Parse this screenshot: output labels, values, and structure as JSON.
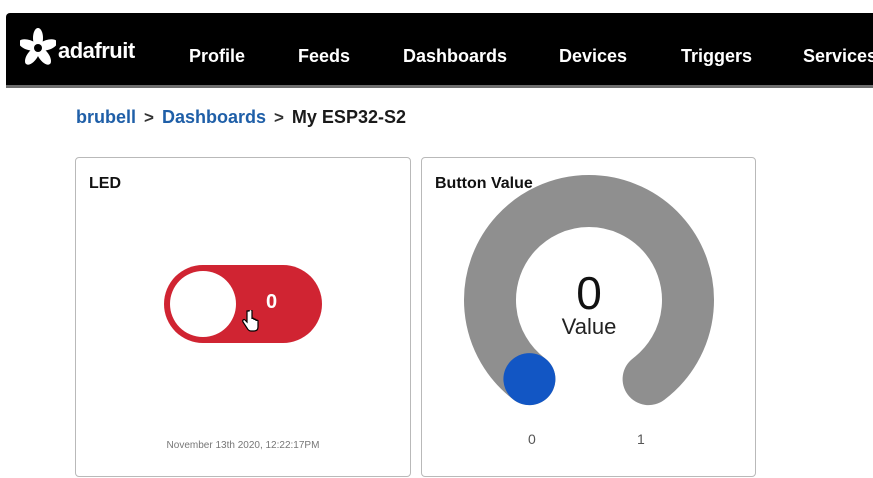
{
  "app": {
    "logo_text": "adafruit"
  },
  "nav": {
    "items": [
      {
        "label": "Profile"
      },
      {
        "label": "Feeds"
      },
      {
        "label": "Dashboards"
      },
      {
        "label": "Devices"
      },
      {
        "label": "Triggers"
      },
      {
        "label": "Services"
      }
    ]
  },
  "breadcrumb": {
    "user": "brubell",
    "section": "Dashboards",
    "current": "My ESP32-S2",
    "separator": ">"
  },
  "led_widget": {
    "title": "LED",
    "toggle_value": "0",
    "toggle_on": false,
    "color": "#d02432",
    "timestamp": "November 13th 2020, 12:22:17PM"
  },
  "gauge_widget": {
    "title": "Button Value",
    "value": "0",
    "value_label": "Value",
    "min": "0",
    "max": "1",
    "level": 0,
    "track_color": "#8f8f8f",
    "knob_color": "#1256c4"
  },
  "colors": {
    "nav_bg": "#000000",
    "link": "#1f5fa8"
  }
}
